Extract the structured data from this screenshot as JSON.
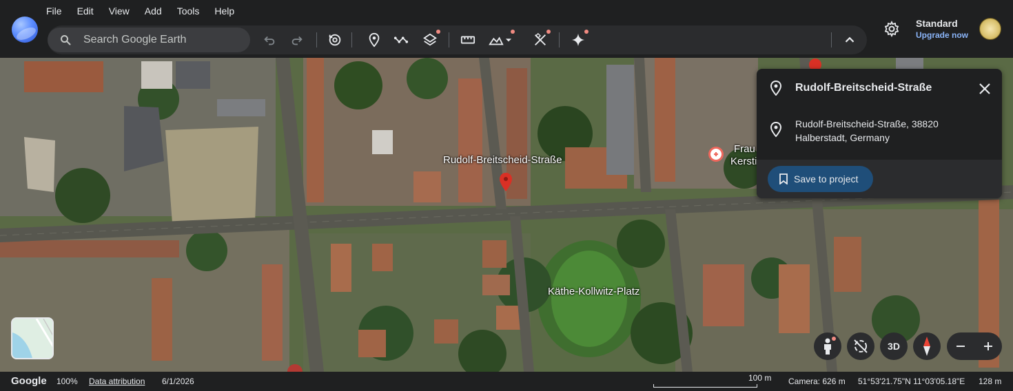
{
  "menu": [
    "File",
    "Edit",
    "View",
    "Add",
    "Tools",
    "Help"
  ],
  "search": {
    "placeholder": "Search Google Earth"
  },
  "toolbar_icons": [
    "undo-icon",
    "redo-icon",
    "history-icon",
    "placemark-icon",
    "path-icon",
    "layers-icon",
    "measure-icon",
    "data-layers-icon",
    "map-style-icon",
    "spark-icon",
    "collapse-icon"
  ],
  "account": {
    "plan": "Standard",
    "upgrade": "Upgrade now"
  },
  "map": {
    "labels": {
      "street": "Rudolf-Breitscheid-Straße",
      "park": "Käthe-Kollwitz-Platz",
      "poi_partial_1": "Frau",
      "poi_partial_2": "Kerstir"
    }
  },
  "card": {
    "title": "Rudolf-Breitscheid-Straße",
    "address_line1": "Rudolf-Breitscheid-Straße, 38820",
    "address_line2": "Halberstadt, Germany",
    "save_label": "Save to project"
  },
  "controls": {
    "three_d": "3D"
  },
  "status": {
    "brand": "Google",
    "zoom": "100%",
    "attribution": "Data attribution",
    "date": "6/1/2026",
    "scale": "100 m",
    "camera": "Camera: 626 m",
    "coords": "51°53'21.75\"N 11°03'05.18\"E",
    "elevation": "128 m"
  },
  "colors": {
    "accent": "#8ab4f8",
    "save_button": "#1f4e79",
    "marker": "#d93025",
    "notification_dot": "#f28b82"
  }
}
